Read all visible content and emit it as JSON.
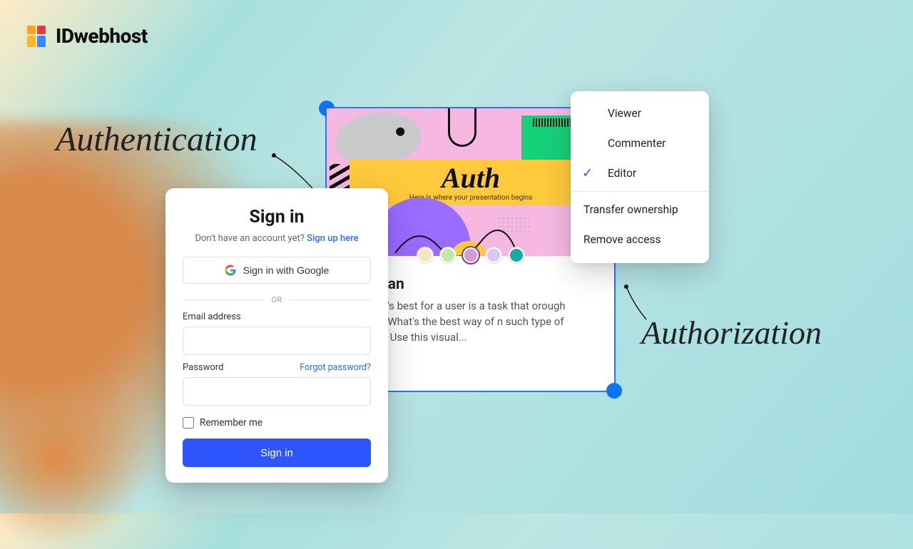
{
  "logo": {
    "text": "IDwebhost"
  },
  "labels": {
    "authentication": "Authentication",
    "authorization": "Authorization"
  },
  "preview": {
    "slide_title": "Auth",
    "slide_subtitle": "Here is where your presentation begins",
    "title_fragment": "arch Plan",
    "description": "ding what's best for a user is a task that orough research. What's the best way of n such type of research? Use this visual...",
    "palette": [
      "#f6e3c5",
      "#bfe9a8",
      "#d69bd3",
      "#d9c6f1",
      "#1aa9a0"
    ],
    "selected_swatch": 2
  },
  "menu": {
    "roles": [
      "Viewer",
      "Commenter",
      "Editor"
    ],
    "selected_role": "Editor",
    "actions": [
      "Transfer ownership",
      "Remove access"
    ]
  },
  "signin": {
    "title": "Sign in",
    "no_account": "Don't have an account yet?",
    "signup_link": "Sign up here",
    "google_button": "Sign in with Google",
    "or": "OR",
    "email_label": "Email address",
    "password_label": "Password",
    "forgot": "Forgot password?",
    "remember": "Remember me",
    "submit": "Sign in"
  }
}
